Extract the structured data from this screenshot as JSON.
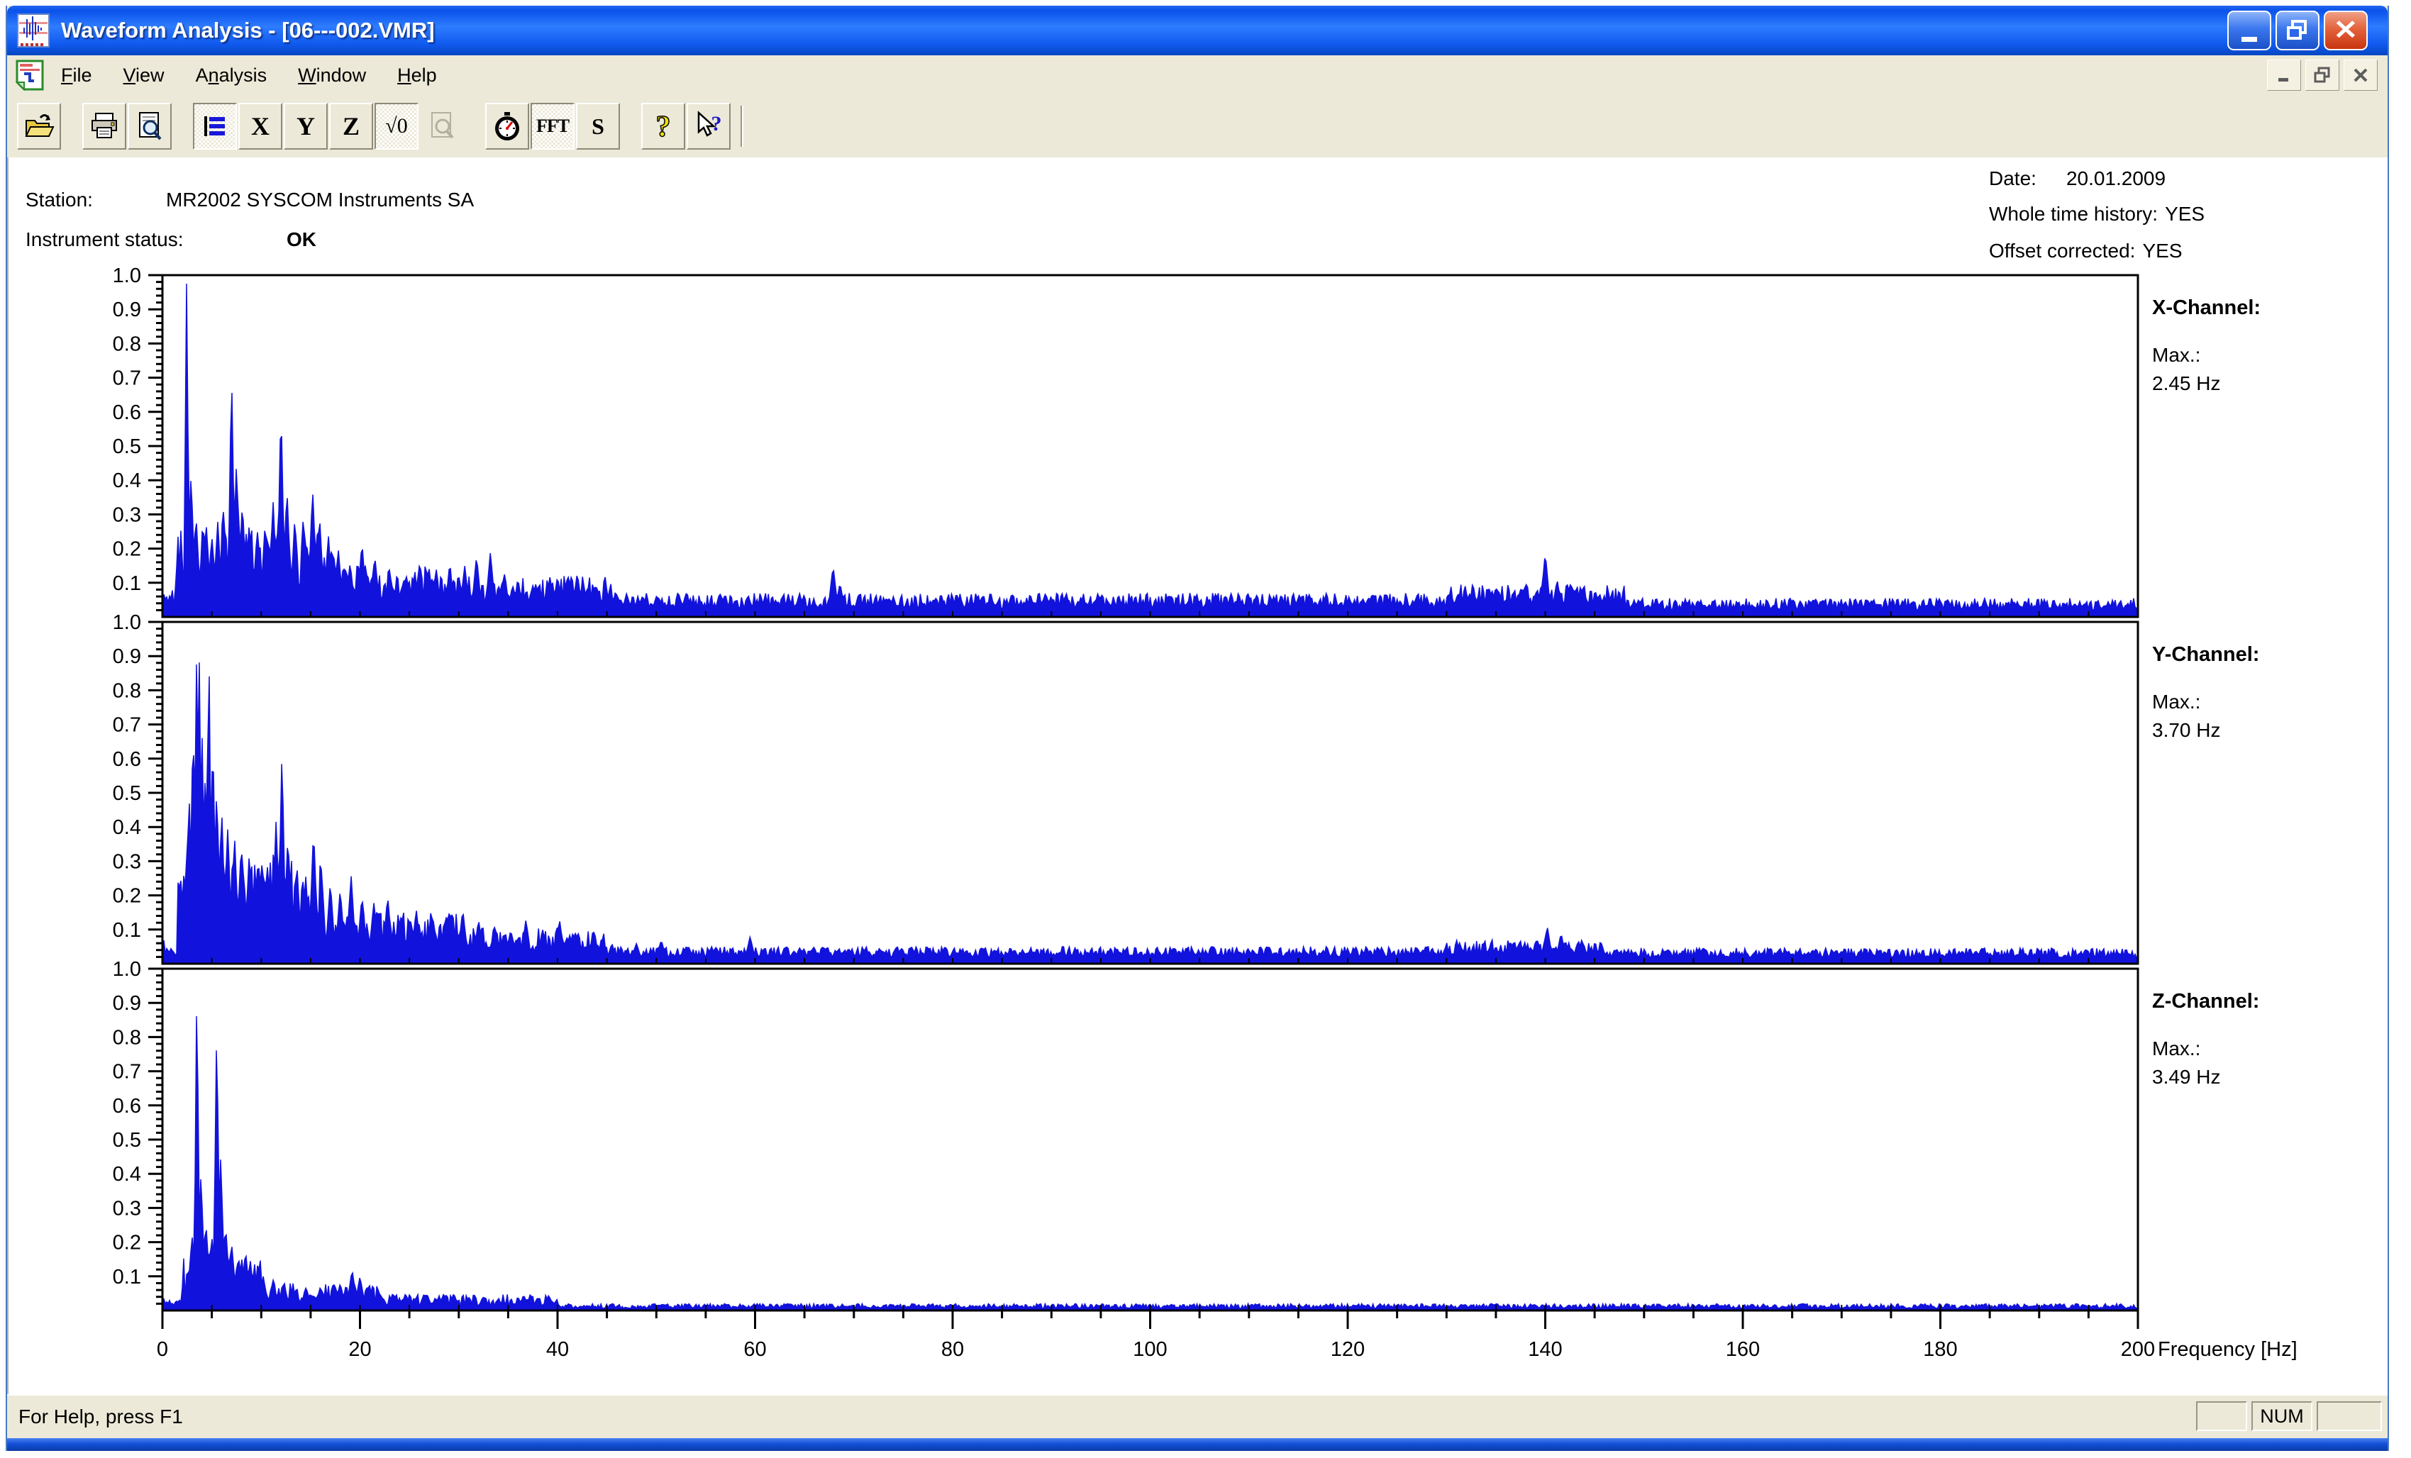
{
  "window": {
    "title": "Waveform Analysis - [06---002.VMR]"
  },
  "menu": {
    "items": [
      {
        "pre": "",
        "accel": "F",
        "post": "ile"
      },
      {
        "pre": "",
        "accel": "V",
        "post": "iew"
      },
      {
        "pre": "A",
        "accel": "n",
        "post": "alysis"
      },
      {
        "pre": "",
        "accel": "W",
        "post": "indow"
      },
      {
        "pre": "",
        "accel": "H",
        "post": "elp"
      }
    ]
  },
  "toolbar": {
    "buttons": [
      {
        "name": "open",
        "icon": "open",
        "state": "normal"
      },
      {
        "name": "print",
        "icon": "print",
        "state": "normal"
      },
      {
        "name": "print-preview",
        "icon": "preview",
        "state": "normal"
      },
      {
        "name": "channel-list",
        "icon": "list",
        "state": "pressed"
      },
      {
        "name": "x-channel",
        "label": "X",
        "state": "normal"
      },
      {
        "name": "y-channel",
        "label": "Y",
        "state": "normal"
      },
      {
        "name": "z-channel",
        "label": "Z",
        "state": "normal"
      },
      {
        "name": "sqrt-zero",
        "label": "√0",
        "state": "pressed"
      },
      {
        "name": "zoom-preview",
        "icon": "zoom",
        "state": "disabled"
      },
      {
        "name": "time-view",
        "icon": "clock",
        "state": "normal"
      },
      {
        "name": "fft-view",
        "label": "FFT",
        "state": "pressed"
      },
      {
        "name": "spectrum-s",
        "label": "S",
        "state": "normal"
      },
      {
        "name": "about-help",
        "icon": "help",
        "state": "normal"
      },
      {
        "name": "context-help",
        "icon": "context-help",
        "state": "normal"
      }
    ]
  },
  "header": {
    "station_label": "Station:",
    "station_value": "MR2002 SYSCOM Instruments SA",
    "status_label": "Instrument status:",
    "status_value": "OK",
    "date_label": "Date:",
    "date_value": "20.01.2009",
    "whole_label": "Whole time history:",
    "whole_value": "YES",
    "offset_label": "Offset corrected:",
    "offset_value": "YES"
  },
  "chart_data": {
    "type": "area",
    "xlabel": "Frequency [Hz]",
    "x_range": [
      0,
      200
    ],
    "y_range": [
      0,
      1.0
    ],
    "x_ticks": [
      "0",
      "20",
      "40",
      "60",
      "80",
      "100",
      "120",
      "140",
      "160",
      "180",
      "200"
    ],
    "y_ticks": [
      "0.1",
      "0.2",
      "0.3",
      "0.4",
      "0.5",
      "0.6",
      "0.7",
      "0.8",
      "0.9",
      "1.0"
    ],
    "line_color": "#1212dd",
    "panels": [
      {
        "title": "X-Channel:",
        "max_label": "Max.:",
        "max_value": "2.45 Hz",
        "seed": 101,
        "peaks": [
          [
            2.45,
            1.0
          ],
          [
            2.9,
            0.42
          ],
          [
            3.4,
            0.3
          ],
          [
            4.2,
            0.26
          ],
          [
            5.0,
            0.24
          ],
          [
            5.6,
            0.28
          ],
          [
            6.2,
            0.32
          ],
          [
            7.0,
            0.73
          ],
          [
            7.5,
            0.46
          ],
          [
            8.1,
            0.34
          ],
          [
            8.8,
            0.28
          ],
          [
            9.6,
            0.26
          ],
          [
            10.4,
            0.28
          ],
          [
            11.2,
            0.34
          ],
          [
            12.0,
            0.63
          ],
          [
            12.6,
            0.38
          ],
          [
            13.4,
            0.28
          ],
          [
            14.4,
            0.26
          ],
          [
            15.2,
            0.38
          ],
          [
            15.9,
            0.3
          ],
          [
            16.8,
            0.24
          ],
          [
            17.8,
            0.2
          ],
          [
            19.0,
            0.16
          ],
          [
            20.2,
            0.22
          ],
          [
            21.5,
            0.18
          ],
          [
            23.0,
            0.14
          ],
          [
            24.5,
            0.12
          ],
          [
            26.0,
            0.15
          ],
          [
            27.5,
            0.11
          ],
          [
            29.0,
            0.12
          ],
          [
            30.6,
            0.15
          ],
          [
            31.8,
            0.18
          ],
          [
            33.2,
            0.19
          ],
          [
            34.6,
            0.13
          ],
          [
            36.0,
            0.11
          ],
          [
            38.0,
            0.09
          ],
          [
            40.0,
            0.12
          ],
          [
            42.0,
            0.13
          ],
          [
            44.0,
            0.09
          ],
          [
            47.0,
            0.07
          ],
          [
            50.0,
            0.06
          ],
          [
            53.0,
            0.07
          ],
          [
            57.0,
            0.06
          ],
          [
            61.0,
            0.06
          ],
          [
            64.5,
            0.07
          ],
          [
            67.9,
            0.15
          ],
          [
            68.6,
            0.1
          ],
          [
            70.5,
            0.07
          ],
          [
            74.0,
            0.06
          ],
          [
            78.0,
            0.05
          ],
          [
            83.0,
            0.06
          ],
          [
            88.0,
            0.05
          ],
          [
            93.0,
            0.06
          ],
          [
            98.0,
            0.05
          ],
          [
            104,
            0.05
          ],
          [
            110,
            0.06
          ],
          [
            116,
            0.05
          ],
          [
            122,
            0.05
          ],
          [
            128,
            0.06
          ],
          [
            132,
            0.07
          ],
          [
            135,
            0.09
          ],
          [
            137.5,
            0.08
          ],
          [
            140,
            0.19
          ],
          [
            141.2,
            0.11
          ],
          [
            143,
            0.08
          ],
          [
            145.5,
            0.07
          ],
          [
            149,
            0.05
          ],
          [
            154,
            0.04
          ],
          [
            160,
            0.04
          ],
          [
            167,
            0.035
          ],
          [
            175,
            0.03
          ],
          [
            183,
            0.03
          ],
          [
            191,
            0.03
          ],
          [
            198,
            0.025
          ]
        ],
        "noise": [
          [
            0,
            1.2,
            0.02,
            0.06
          ],
          [
            1.2,
            18,
            0.06,
            0.22
          ],
          [
            18,
            30,
            0.05,
            0.1
          ],
          [
            30,
            46,
            0.04,
            0.08
          ],
          [
            46,
            130,
            0.025,
            0.045
          ],
          [
            130,
            148,
            0.035,
            0.06
          ],
          [
            148,
            200,
            0.02,
            0.035
          ]
        ]
      },
      {
        "title": "Y-Channel:",
        "max_label": "Max.:",
        "max_value": "3.70 Hz",
        "seed": 202,
        "peaks": [
          [
            2.2,
            0.28
          ],
          [
            2.7,
            0.5
          ],
          [
            3.1,
            0.72
          ],
          [
            3.45,
            0.88
          ],
          [
            3.7,
            1.0
          ],
          [
            4.0,
            0.7
          ],
          [
            4.35,
            0.58
          ],
          [
            4.7,
            0.97
          ],
          [
            5.1,
            0.68
          ],
          [
            5.5,
            0.52
          ],
          [
            6.0,
            0.46
          ],
          [
            6.6,
            0.4
          ],
          [
            7.3,
            0.38
          ],
          [
            8.0,
            0.35
          ],
          [
            8.8,
            0.33
          ],
          [
            9.7,
            0.32
          ],
          [
            10.6,
            0.3
          ],
          [
            11.5,
            0.42
          ],
          [
            12.1,
            0.63
          ],
          [
            12.7,
            0.38
          ],
          [
            13.6,
            0.3
          ],
          [
            14.5,
            0.26
          ],
          [
            15.3,
            0.4
          ],
          [
            16.1,
            0.28
          ],
          [
            17.0,
            0.24
          ],
          [
            18.0,
            0.22
          ],
          [
            19.1,
            0.26
          ],
          [
            20.2,
            0.2
          ],
          [
            21.4,
            0.18
          ],
          [
            22.8,
            0.2
          ],
          [
            24.2,
            0.15
          ],
          [
            25.7,
            0.16
          ],
          [
            27.2,
            0.13
          ],
          [
            28.8,
            0.11
          ],
          [
            30.4,
            0.16
          ],
          [
            32.0,
            0.13
          ],
          [
            33.6,
            0.11
          ],
          [
            35.2,
            0.09
          ],
          [
            36.8,
            0.13
          ],
          [
            38.5,
            0.1
          ],
          [
            40.2,
            0.13
          ],
          [
            41.8,
            0.09
          ],
          [
            43.5,
            0.07
          ],
          [
            45.5,
            0.06
          ],
          [
            48.0,
            0.06
          ],
          [
            50.5,
            0.07
          ],
          [
            53.0,
            0.05
          ],
          [
            56.0,
            0.05
          ],
          [
            59.5,
            0.08
          ],
          [
            63.0,
            0.05
          ],
          [
            67.0,
            0.05
          ],
          [
            71.0,
            0.04
          ],
          [
            76.0,
            0.04
          ],
          [
            81.0,
            0.04
          ],
          [
            86.0,
            0.035
          ],
          [
            91.0,
            0.035
          ],
          [
            96.0,
            0.03
          ],
          [
            102,
            0.03
          ],
          [
            108,
            0.03
          ],
          [
            114,
            0.03
          ],
          [
            120,
            0.03
          ],
          [
            126,
            0.035
          ],
          [
            131,
            0.04
          ],
          [
            135,
            0.05
          ],
          [
            138,
            0.05
          ],
          [
            140.2,
            0.11
          ],
          [
            141.6,
            0.09
          ],
          [
            143.5,
            0.05
          ],
          [
            147,
            0.04
          ],
          [
            152,
            0.035
          ],
          [
            158,
            0.03
          ],
          [
            165,
            0.03
          ],
          [
            172,
            0.025
          ],
          [
            180,
            0.025
          ],
          [
            188,
            0.025
          ],
          [
            196,
            0.02
          ]
        ],
        "noise": [
          [
            0,
            1.5,
            0.02,
            0.05
          ],
          [
            1.5,
            16,
            0.07,
            0.25
          ],
          [
            16,
            30,
            0.05,
            0.1
          ],
          [
            30,
            45,
            0.035,
            0.07
          ],
          [
            45,
            130,
            0.02,
            0.03
          ],
          [
            130,
            146,
            0.025,
            0.045
          ],
          [
            146,
            200,
            0.018,
            0.028
          ]
        ]
      },
      {
        "title": "Z-Channel:",
        "max_label": "Max.:",
        "max_value": "3.49 Hz",
        "seed": 303,
        "peaks": [
          [
            3.0,
            0.22
          ],
          [
            3.49,
            1.0
          ],
          [
            3.9,
            0.4
          ],
          [
            4.4,
            0.26
          ],
          [
            5.0,
            0.22
          ],
          [
            5.5,
            0.86
          ],
          [
            5.9,
            0.45
          ],
          [
            6.4,
            0.25
          ],
          [
            7.0,
            0.2
          ],
          [
            7.7,
            0.16
          ],
          [
            8.5,
            0.14
          ],
          [
            9.3,
            0.12
          ],
          [
            10.2,
            0.1
          ],
          [
            11.2,
            0.09
          ],
          [
            12.3,
            0.08
          ],
          [
            13.5,
            0.06
          ],
          [
            15.0,
            0.05
          ],
          [
            16.5,
            0.05
          ],
          [
            18.0,
            0.08
          ],
          [
            19.2,
            0.12
          ],
          [
            20.0,
            0.1
          ],
          [
            20.8,
            0.07
          ],
          [
            22.0,
            0.05
          ],
          [
            23.5,
            0.04
          ],
          [
            25.0,
            0.04
          ],
          [
            26.5,
            0.05
          ],
          [
            28.0,
            0.04
          ],
          [
            29.5,
            0.05
          ],
          [
            31.0,
            0.04
          ],
          [
            32.5,
            0.04
          ],
          [
            34.0,
            0.035
          ],
          [
            36.0,
            0.03
          ],
          [
            38.0,
            0.025
          ],
          [
            40.0,
            0.02
          ],
          [
            43.0,
            0.015
          ],
          [
            46.0,
            0.012
          ],
          [
            50.0,
            0.012
          ],
          [
            55.0,
            0.01
          ],
          [
            60.0,
            0.01
          ],
          [
            70.0,
            0.008
          ],
          [
            80.0,
            0.008
          ],
          [
            90.0,
            0.008
          ],
          [
            100,
            0.007
          ],
          [
            120,
            0.006
          ],
          [
            140,
            0.01
          ],
          [
            160,
            0.005
          ],
          [
            180,
            0.005
          ]
        ],
        "noise": [
          [
            0,
            2,
            0.01,
            0.03
          ],
          [
            2,
            10,
            0.04,
            0.12
          ],
          [
            10,
            22,
            0.02,
            0.06
          ],
          [
            22,
            40,
            0.012,
            0.035
          ],
          [
            40,
            200,
            0.006,
            0.014
          ]
        ]
      }
    ]
  },
  "status_bar": {
    "message": "For Help, press F1",
    "num": "NUM"
  }
}
